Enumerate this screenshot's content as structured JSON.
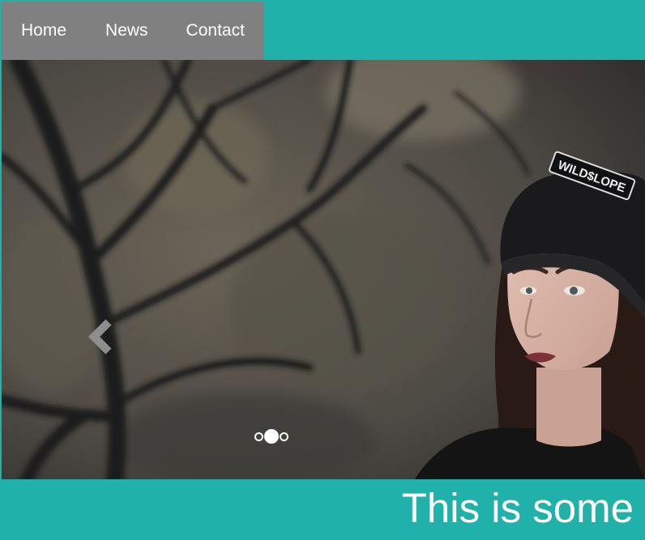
{
  "nav": {
    "items": [
      {
        "label": "Home"
      },
      {
        "label": "News"
      },
      {
        "label": "Contact"
      }
    ]
  },
  "slider": {
    "prev_icon": "chevron-left-icon",
    "slide_count": 3,
    "active_slide": 2,
    "beanie_text": "WILD$LOPE"
  },
  "caption": {
    "text": "This is some"
  },
  "colors": {
    "accent": "#20b2aa",
    "nav_background": "#808080",
    "text": "#ffffff"
  }
}
